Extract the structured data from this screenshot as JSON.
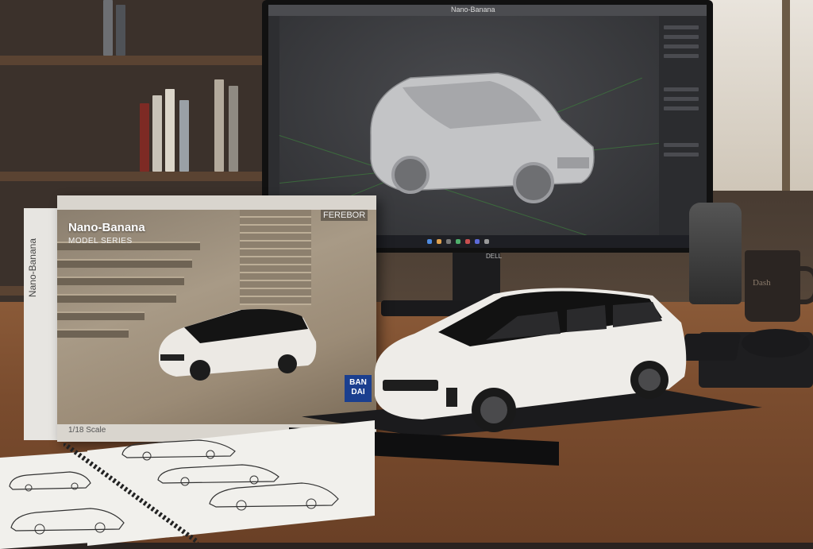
{
  "scene": {
    "description_labels": {
      "monitor_menubar_title": "Nano-Banana",
      "box_title": "Nano-Banana",
      "box_subtitle": "MODEL SERIES",
      "box_side_text": "Nano-Banana",
      "box_brand_tag": "FEREBOR",
      "box_badge": "BAN DAI",
      "box_scale": "1/18 Scale",
      "monitor_logo": "DELL",
      "mug_text": "Dash"
    }
  },
  "colors": {
    "car_body": "#e9e7e3",
    "car_roof": "#151515",
    "render_car": "#bfc0c2",
    "grid": "#3d7d3d",
    "desk": "#7a4c2e"
  }
}
